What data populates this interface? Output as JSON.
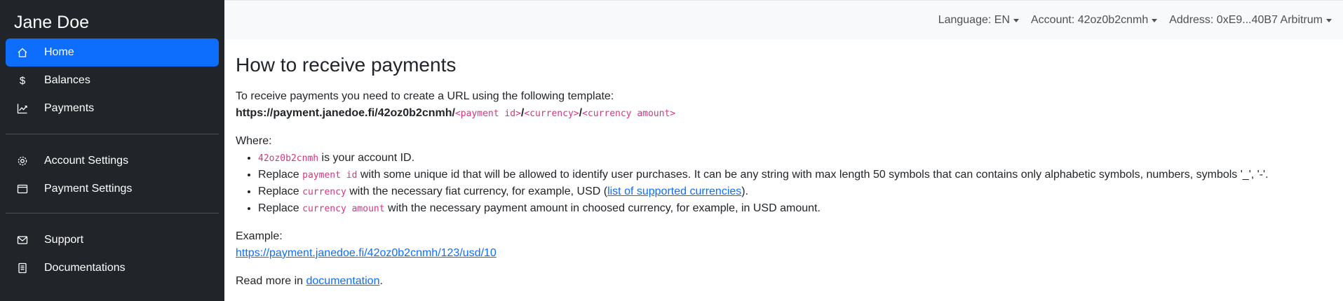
{
  "sidebar": {
    "brand": "Jane Doe",
    "items": [
      {
        "label": "Home",
        "icon": "home-icon",
        "active": true
      },
      {
        "label": "Balances",
        "icon": "dollar-icon"
      },
      {
        "label": "Payments",
        "icon": "chart-line-icon"
      },
      {
        "label": "Account Settings",
        "icon": "gear-icon"
      },
      {
        "label": "Payment Settings",
        "icon": "card-icon"
      },
      {
        "label": "Support",
        "icon": "envelope-icon"
      },
      {
        "label": "Documentations",
        "icon": "document-icon"
      }
    ]
  },
  "topbar": {
    "language": "Language: EN",
    "account": "Account: 42oz0b2cnmh",
    "address": "Address: 0xE9...40B7 Arbitrum"
  },
  "main": {
    "title": "How to receive payments",
    "intro": "To receive payments you need to create a URL using the following template:",
    "template_base": "https://payment.janedoe.fi/42oz0b2cnmh/",
    "template_payment_id": "<payment id>",
    "template_slash1": "/",
    "template_currency": "<currency>",
    "template_slash2": "/",
    "template_amount": "<currency amount>",
    "where": "Where:",
    "bullets": {
      "b1_code": "42oz0b2cnmh",
      "b1_text": " is your account ID.",
      "b2_pre": "Replace ",
      "b2_code": "payment id",
      "b2_text": " with some unique id that will be allowed to identify user purchases. It can be any string with max length 50 symbols that can contains only alphabetic symbols, numbers, symbols '_', '-'.",
      "b3_pre": "Replace ",
      "b3_code": "currency",
      "b3_text": " with the necessary fiat currency, for example, USD (",
      "b3_link": "list of supported currencies",
      "b3_end": ").",
      "b4_pre": "Replace ",
      "b4_code": "currency amount",
      "b4_text": " with the necessary payment amount in choosed currency, for example, in USD amount."
    },
    "example_label": "Example:",
    "example_link": "https://payment.janedoe.fi/42oz0b2cnmh/123/usd/10",
    "read_more": "Read more in ",
    "read_more_link": "documentation",
    "read_more_end": "."
  },
  "colors": {
    "sidebar_bg": "#212529",
    "active_bg": "#0d6efd",
    "code": "#d63384",
    "link": "#0d6efd"
  }
}
